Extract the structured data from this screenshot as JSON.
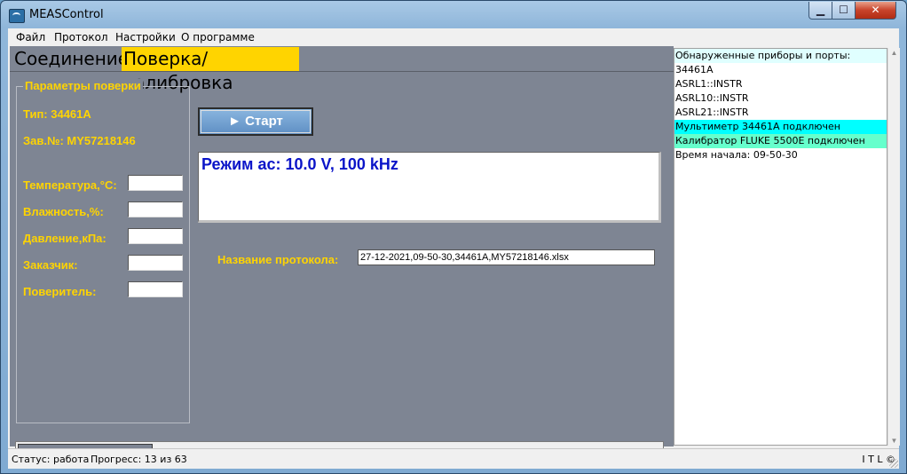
{
  "window": {
    "title": "MEASControl",
    "min": "0",
    "max": "1",
    "close": "r"
  },
  "menu": [
    "Файл",
    "Протокол",
    "Настройки",
    "О программе"
  ],
  "tabs": [
    "Соединение",
    "Поверка/калибровка"
  ],
  "group": {
    "title": "Параметры поверки",
    "type_label": "Тип: 34461A",
    "serial_label": "Зав.№: MY57218146",
    "fields": [
      {
        "label": "Температура,°C:",
        "value": ""
      },
      {
        "label": "Влажность,%:",
        "value": ""
      },
      {
        "label": "Давление,кПа:",
        "value": ""
      },
      {
        "label": "Заказчик:",
        "value": ""
      },
      {
        "label": "Поверитель:",
        "value": ""
      }
    ]
  },
  "start_button": "► Старт",
  "mode_text": "Режим ac: 10.0 V, 100 kHz",
  "protocol": {
    "label": "Название протокола:",
    "value": "27-12-2021,09-50-30,34461A,MY57218146.xlsx"
  },
  "progress_fraction": 0.21,
  "log": [
    {
      "text": "Обнаруженные приборы и порты:",
      "bg": "#e0ffff"
    },
    {
      "text": "34461A",
      "bg": ""
    },
    {
      "text": "ASRL1::INSTR",
      "bg": ""
    },
    {
      "text": "ASRL10::INSTR",
      "bg": ""
    },
    {
      "text": "ASRL21::INSTR",
      "bg": ""
    },
    {
      "text": "Мультиметр 34461A подключен",
      "bg": "#00ffff"
    },
    {
      "text": "Калибратор FLUKE 5500E подключен",
      "bg": "#66ffcc"
    },
    {
      "text": "Время начала: 09-50-30",
      "bg": ""
    }
  ],
  "status": {
    "state": "Статус: работа",
    "progress": "Прогресс: 13 из 63",
    "brand": "I T L ©"
  },
  "colors": {
    "accent_yellow": "#ffd400",
    "panel_gray": "#7e8593",
    "mode_blue": "#0a14c8"
  }
}
